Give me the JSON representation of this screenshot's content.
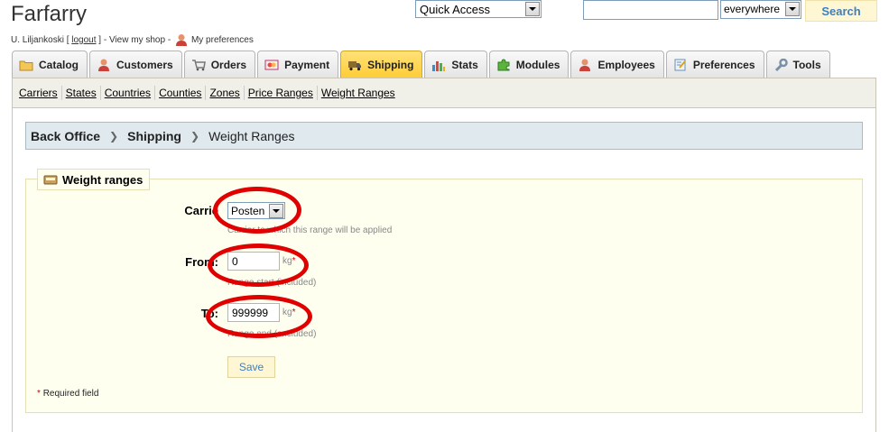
{
  "header": {
    "shop_name": "Farfarry",
    "user_name": "U. Liljankoski",
    "logout_label": "logout",
    "view_shop_label": "View my shop",
    "preferences_label": "My preferences",
    "quick_access_label": "Quick Access",
    "search_value": "",
    "scope_value": "everywhere",
    "search_button_label": "Search"
  },
  "tabs": [
    {
      "label": "Catalog",
      "icon": "folder-icon"
    },
    {
      "label": "Customers",
      "icon": "customers-icon"
    },
    {
      "label": "Orders",
      "icon": "cart-icon"
    },
    {
      "label": "Payment",
      "icon": "payment-icon"
    },
    {
      "label": "Shipping",
      "icon": "truck-icon",
      "active": true
    },
    {
      "label": "Stats",
      "icon": "chart-icon"
    },
    {
      "label": "Modules",
      "icon": "puzzle-icon"
    },
    {
      "label": "Employees",
      "icon": "employee-icon"
    },
    {
      "label": "Preferences",
      "icon": "preferences-icon"
    },
    {
      "label": "Tools",
      "icon": "wrench-icon"
    }
  ],
  "subnav": [
    "Carriers",
    "States",
    "Countries",
    "Counties",
    "Zones",
    "Price Ranges",
    "Weight Ranges"
  ],
  "breadcrumb": {
    "root": "Back Office",
    "section": "Shipping",
    "current": "Weight Ranges"
  },
  "form": {
    "legend": "Weight ranges",
    "carrier_label": "Carrie",
    "carrier_value": "Posten",
    "carrier_hint": "Carrier to which this range will be applied",
    "from_label": "From:",
    "from_value": "0",
    "from_hint": "Range start (included)",
    "to_label": "To:",
    "to_value": "999999",
    "to_hint": "Range end (excluded)",
    "unit": "kg",
    "required_mark": "*",
    "save_label": "Save",
    "required_note": "Required field"
  },
  "colors": {
    "active_tab": "#ffcc33",
    "annotation_ring": "#e00000",
    "fieldset_bg": "#fffff0",
    "breadcrumb_bg": "#dfe9ee"
  }
}
